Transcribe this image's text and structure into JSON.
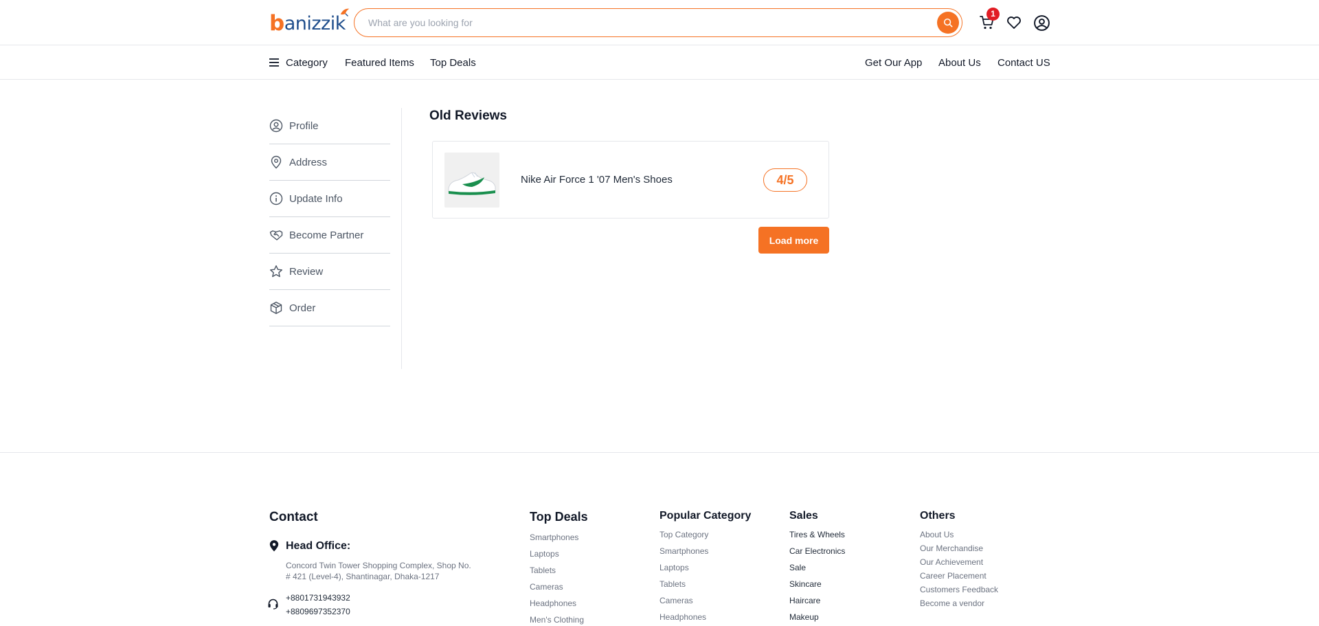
{
  "header": {
    "logo_text": "banizzik",
    "search": {
      "placeholder": "What are you looking for",
      "value": ""
    },
    "cart_count": "1",
    "accent_color": "#f57224"
  },
  "nav": {
    "category": "Category",
    "featured": "Featured Items",
    "top_deals": "Top Deals",
    "get_app": "Get Our App",
    "about": "About Us",
    "contact": "Contact US"
  },
  "sidebar": {
    "items": [
      {
        "label": "Profile",
        "icon": "user-circle-icon"
      },
      {
        "label": "Address",
        "icon": "location-pin-icon"
      },
      {
        "label": "Update Info",
        "icon": "info-icon"
      },
      {
        "label": "Become Partner",
        "icon": "handshake-icon"
      },
      {
        "label": "Review",
        "icon": "star-icon"
      },
      {
        "label": "Order",
        "icon": "box-icon"
      }
    ]
  },
  "main": {
    "title": "Old Reviews",
    "reviews": [
      {
        "product": "Nike Air Force 1 '07 Men's Shoes",
        "rating": "4/5"
      }
    ],
    "load_more": "Load more"
  },
  "footer": {
    "contact": {
      "title": "Contact",
      "office_title": "Head Office:",
      "address_line1": "Concord Twin Tower Shopping Complex, Shop No.",
      "address_line2": "# 421 (Level-4), Shantinagar, Dhaka-1217",
      "phone1": "+8801731943932",
      "phone2": "+8809697352370"
    },
    "top_deals": {
      "title": "Top Deals",
      "links": [
        "Smartphones",
        "Laptops",
        "Tablets",
        "Cameras",
        "Headphones",
        "Men's Clothing"
      ]
    },
    "popular_category": {
      "title": "Popular Category",
      "links": [
        "Top Category",
        "Smartphones",
        "Laptops",
        "Tablets",
        "Cameras",
        "Headphones"
      ]
    },
    "sales": {
      "title": "Sales",
      "links": [
        "Tires & Wheels",
        "Car Electronics",
        "Sale",
        "Skincare",
        "Haircare",
        "Makeup"
      ]
    },
    "others": {
      "title": "Others",
      "links": [
        "About Us",
        "Our Merchandise",
        "Our Achievement",
        "Career Placement",
        "Customers Feedback",
        "Become a vendor"
      ]
    }
  }
}
